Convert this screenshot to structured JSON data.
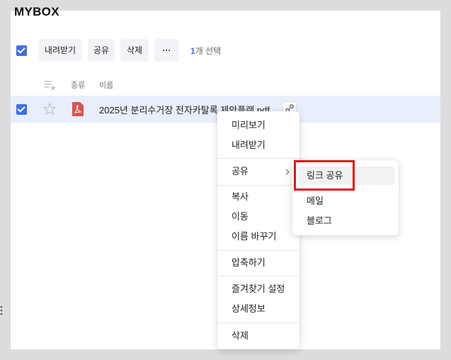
{
  "app": {
    "title": "MYBOX"
  },
  "toolbar": {
    "download_label": "내려받기",
    "share_label": "공유",
    "delete_label": "삭제",
    "more_label": "···",
    "selected_count": "1",
    "selected_suffix": "개 선택"
  },
  "table": {
    "columns": {
      "type": "종류",
      "name": "이름"
    },
    "rows": [
      {
        "name": "2025년 분리수거장 전자카탈록 제안플랜.pdf",
        "file_type": "pdf"
      }
    ]
  },
  "context_menu": {
    "items": [
      {
        "label": "미리보기"
      },
      {
        "label": "내려받기"
      },
      {
        "label": "공유"
      },
      {
        "label": "복사"
      },
      {
        "label": "이동"
      },
      {
        "label": "이름 바꾸기"
      },
      {
        "label": "압축하기"
      },
      {
        "label": "즐겨찾기 설정"
      },
      {
        "label": "상세정보"
      },
      {
        "label": "삭제"
      }
    ]
  },
  "share_submenu": {
    "items": [
      {
        "label": "링크 공유"
      },
      {
        "label": "메일"
      },
      {
        "label": "블로그"
      }
    ]
  },
  "colors": {
    "accent": "#3f6fe6",
    "pdf": "#d9534f",
    "highlight": "#e2141c",
    "row_selected": "#e9eefc"
  }
}
